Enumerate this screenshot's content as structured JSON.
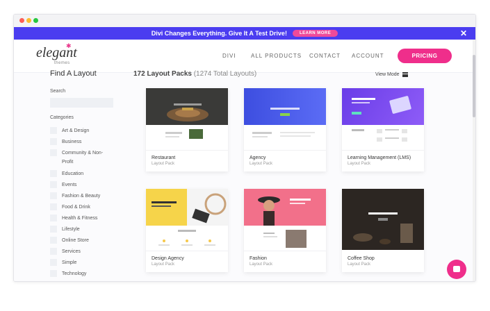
{
  "banner": {
    "text": "Divi Changes Everything. Give It A Test Drive!",
    "button": "LEARN MORE"
  },
  "logo": {
    "main": "elegant",
    "sub": "themes"
  },
  "nav": {
    "items": [
      "DIVI",
      "ALL PRODUCTS",
      "CONTACT",
      "ACCOUNT"
    ],
    "pricing": "PRICING"
  },
  "sidebar": {
    "title": "Find A Layout",
    "search_label": "Search",
    "categories_label": "Categories",
    "categories": [
      "Art & Design",
      "Business",
      "Community & Non-Profit",
      "Education",
      "Events",
      "Fashion & Beauty",
      "Food & Drink",
      "Health & Fitness",
      "Lifestyle",
      "Online Store",
      "Services",
      "Simple",
      "Technology"
    ]
  },
  "main": {
    "count_title": "172 Layout Packs",
    "count_sub": "(1274 Total Layouts)",
    "view_mode": "View Mode",
    "cards": [
      {
        "name": "Restaurant",
        "type": "Layout Pack"
      },
      {
        "name": "Agency",
        "type": "Layout Pack"
      },
      {
        "name": "Learning Management (LMS)",
        "type": "Layout Pack"
      },
      {
        "name": "Design Agency",
        "type": "Layout Pack"
      },
      {
        "name": "Fashion",
        "type": "Layout Pack"
      },
      {
        "name": "Coffee Shop",
        "type": "Layout Pack"
      }
    ]
  },
  "colors": {
    "brand_purple": "#4b3df0",
    "brand_pink": "#ef2e8b"
  }
}
